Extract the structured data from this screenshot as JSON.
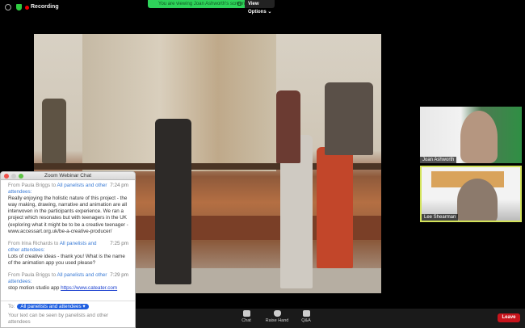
{
  "topbar": {
    "recording_label": "Recording",
    "banner_text": "You are viewing Joan Ashworth's screen",
    "view_options_label": "View Options ⌄"
  },
  "participants": [
    {
      "name": "Joan Ashworth"
    },
    {
      "name": "Lee Shearman"
    }
  ],
  "chat": {
    "title": "Zoom Webinar Chat",
    "messages": [
      {
        "from": "From Paula Briggs to ",
        "to": "All panelists and other attendees:",
        "time": "7:24 pm",
        "text": "Really enjoying the holistic nature of this project - the way making, drawing, narrative  and animation are all interwoven in the participants experience. We ran a project which resonates but with teenagers in the UK (exploring what it might be to be a creative teenager - www.accessart.org.uk/be-a-creative-producer/"
      },
      {
        "from": "From Irina Richards to ",
        "to": "All panelists and other attendees:",
        "time": "7:25 pm",
        "text": "Lots of creative ideas - thank you! What is the name of the animation app you used please?"
      },
      {
        "from": "From Paula Briggs to ",
        "to": "All panelists and other attendees:",
        "time": "7:29 pm",
        "text": "stop motion studio app ",
        "link": "https://www.cateater.com"
      }
    ],
    "to_label": "To:",
    "to_value": "All panelists and attendees ▾",
    "note": "Your text can be seen by panelists and other attendees"
  },
  "toolbar": {
    "chat": "Chat",
    "raise_hand": "Raise Hand",
    "qa": "Q&A",
    "leave": "Leave"
  }
}
